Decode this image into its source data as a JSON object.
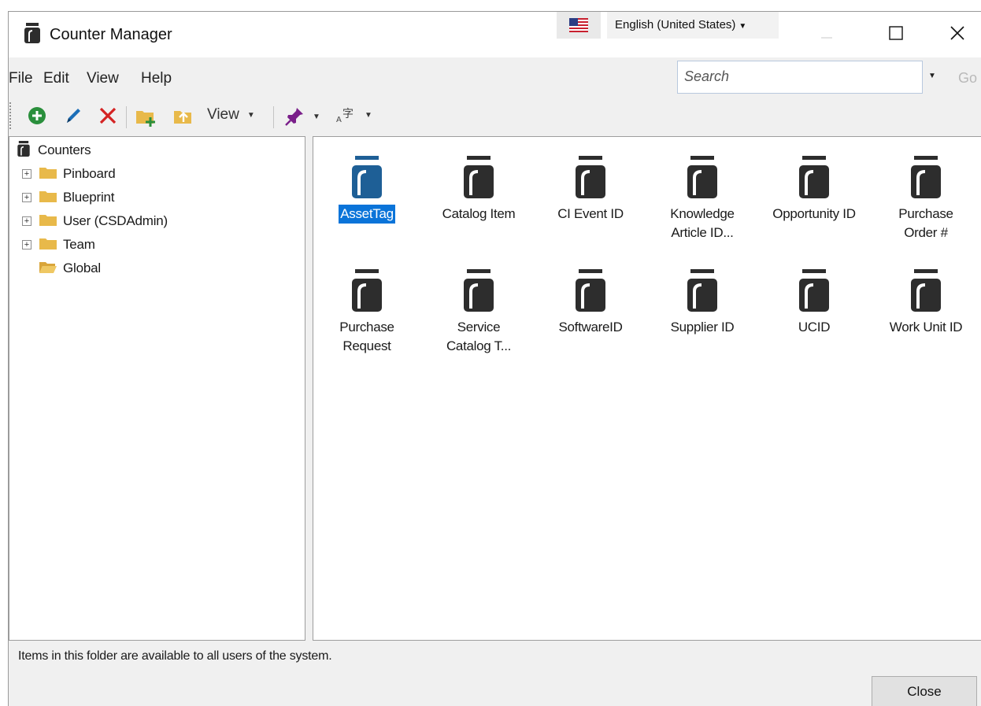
{
  "window": {
    "title": "Counter Manager",
    "language": "English (United States)",
    "controls": {
      "minimize": "—",
      "maximize": "☐",
      "close": "✕"
    }
  },
  "menu": {
    "items": [
      "File",
      "Edit",
      "View",
      "Help"
    ],
    "search_placeholder": "Search",
    "go_label": "Go"
  },
  "toolbar": {
    "view_label": "View",
    "icons": [
      "add-icon",
      "edit-icon",
      "delete-icon",
      "new-folder-icon",
      "move-folder-icon",
      "pin-icon",
      "language-icon"
    ]
  },
  "tree": {
    "root": "Counters",
    "items": [
      {
        "label": "Pinboard",
        "expander": "+"
      },
      {
        "label": "Blueprint",
        "expander": "+"
      },
      {
        "label": "User (CSDAdmin)",
        "expander": "+"
      },
      {
        "label": "Team",
        "expander": "+"
      },
      {
        "label": "Global",
        "expander": "",
        "open": true
      }
    ]
  },
  "counters": {
    "items": [
      {
        "line1": "AssetTag",
        "line2": "",
        "selected": true
      },
      {
        "line1": "Catalog Item",
        "line2": ""
      },
      {
        "line1": "CI Event ID",
        "line2": ""
      },
      {
        "line1": "Knowledge",
        "line2": "Article ID..."
      },
      {
        "line1": "Opportunity ID",
        "line2": ""
      },
      {
        "line1": "Purchase",
        "line2": "Order #"
      },
      {
        "line1": "Purchase",
        "line2": "Request"
      },
      {
        "line1": "Service",
        "line2": "Catalog T..."
      },
      {
        "line1": "SoftwareID",
        "line2": ""
      },
      {
        "line1": "Supplier ID",
        "line2": ""
      },
      {
        "line1": "UCID",
        "line2": ""
      },
      {
        "line1": "Work Unit ID",
        "line2": ""
      }
    ]
  },
  "status": {
    "text": "Items in this folder are available to all users of the system.",
    "close_label": "Close"
  },
  "colors": {
    "selection": "#0a74d9",
    "counter_icon_selected": "#1e5f96",
    "counter_icon": "#2d2d2d",
    "folder": "#e8b94a"
  }
}
